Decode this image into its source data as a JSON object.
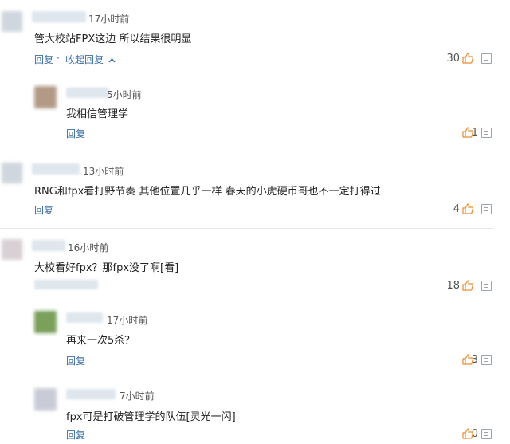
{
  "c1": {
    "time": "17小时前",
    "text": "管大校站FPX这边 所以结果很明显",
    "reply": "回复",
    "dot": "·",
    "collapse": "收起回复",
    "likes": "30"
  },
  "r1": {
    "time": "5小时前",
    "text": "我相信管理学",
    "reply": "回复",
    "likes": "1"
  },
  "c2": {
    "time": "13小时前",
    "text": "RNG和fpx看打野节奏 其他位置几乎一样 春天的小虎硬币哥也不一定打得过",
    "reply": "回复",
    "likes": "4"
  },
  "c3": {
    "time": "16小时前",
    "text": "大校看好fpx？那fpx没了啊[看]",
    "likes": "18"
  },
  "r2": {
    "time": "17小时前",
    "text": "再来一次5杀？",
    "reply": "回复",
    "likes": "3"
  },
  "r3": {
    "time": "7小时前",
    "text": "fpx可是打破管理学的队伍[灵光一闪]",
    "reply": "回复",
    "likes": "0"
  },
  "colors": {
    "link": "#3b6ea8",
    "thumb": "#f08a2a",
    "separator": "#e6e6e6"
  },
  "icons": {
    "like": "thumbs-up-icon",
    "report": "report-icon",
    "collapse": "chevron-up-icon"
  }
}
